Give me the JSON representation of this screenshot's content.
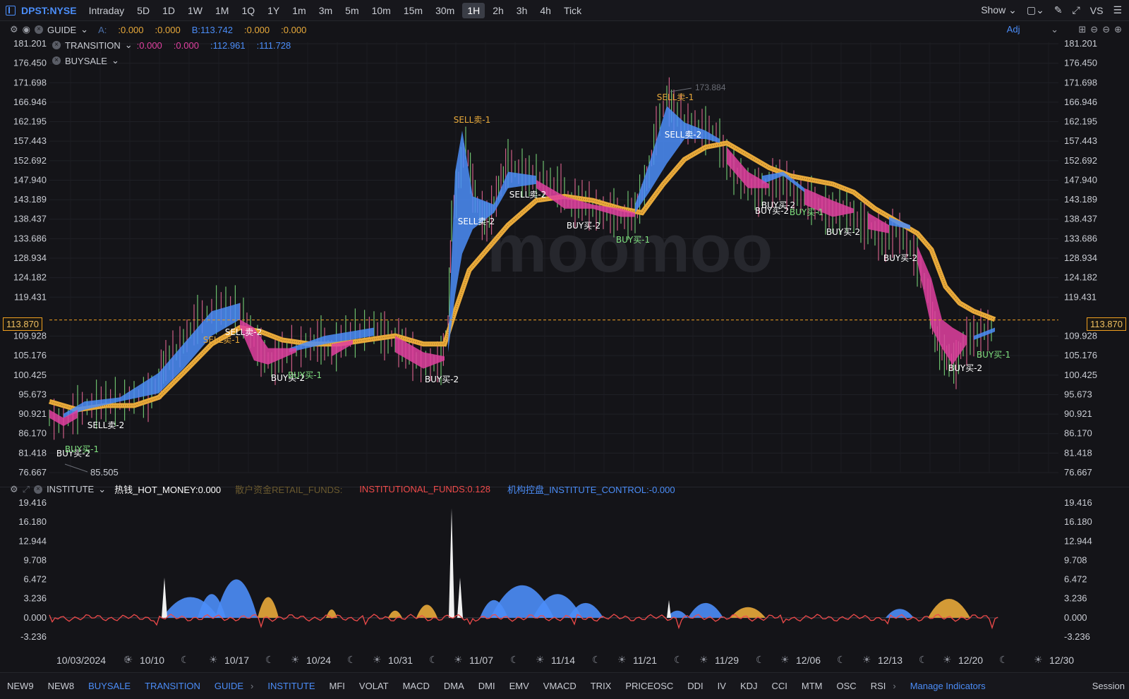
{
  "topbar": {
    "symbol": "DPST:NYSE",
    "timeframes": [
      "Intraday",
      "5D",
      "1D",
      "1W",
      "1M",
      "1Q",
      "1Y",
      "1m",
      "3m",
      "5m",
      "10m",
      "15m",
      "30m",
      "1H",
      "2h",
      "3h",
      "4h",
      "Tick"
    ],
    "active_timeframe": "1H",
    "show_label": "Show",
    "vs_label": "VS"
  },
  "main_panel": {
    "indicators": [
      {
        "name": "GUIDE",
        "values": [
          "A:",
          ":0.000",
          ":0.000",
          "B:113.742",
          ":0.000",
          ":0.000"
        ]
      },
      {
        "name": "TRANSITION",
        "values": [
          ":0.000",
          ":0.000",
          ":112.961",
          ":111.728"
        ]
      },
      {
        "name": "BUYSALE",
        "values": []
      }
    ],
    "adj_label": "Adj",
    "watermark": "moomoo",
    "current_price": "113.870",
    "high_label": "173.884",
    "low_label": "85.505",
    "price_axis": [
      "181.201",
      "176.450",
      "171.698",
      "166.946",
      "162.195",
      "157.443",
      "152.692",
      "147.940",
      "143.189",
      "138.437",
      "133.686",
      "128.934",
      "124.182",
      "119.431",
      "109.928",
      "105.176",
      "100.425",
      "95.673",
      "90.921",
      "86.170",
      "81.418",
      "76.667"
    ],
    "signals": [
      {
        "text": "SELL卖-1",
        "color": "#e8a93a"
      },
      {
        "text": "SELL卖-1",
        "color": "#e8a93a"
      },
      {
        "text": "SELL卖-1",
        "color": "#e8a93a"
      },
      {
        "text": "SELL卖-2",
        "color": "#ffffff"
      },
      {
        "text": "SELL卖-2",
        "color": "#ffffff"
      },
      {
        "text": "SELL卖-2",
        "color": "#ffffff"
      },
      {
        "text": "SELL卖-2",
        "color": "#ffffff"
      },
      {
        "text": "SELL卖-2",
        "color": "#ffffff"
      },
      {
        "text": "BUY买-2",
        "color": "#ffffff"
      },
      {
        "text": "BUY买-1",
        "color": "#7ee07e"
      },
      {
        "text": "BUY买-2",
        "color": "#ffffff"
      },
      {
        "text": "BUY买-1",
        "color": "#7ee07e"
      },
      {
        "text": "BUY买-2",
        "color": "#ffffff"
      },
      {
        "text": "BUY买-2",
        "color": "#ffffff"
      },
      {
        "text": "BUY买-1",
        "color": "#7ee07e"
      },
      {
        "text": "BUY买-2",
        "color": "#ffffff"
      },
      {
        "text": "BUY买-2",
        "color": "#ffffff"
      },
      {
        "text": "BUY买-1",
        "color": "#7ee07e"
      },
      {
        "text": "BUY买-2",
        "color": "#ffffff"
      },
      {
        "text": "BUY买-2",
        "color": "#ffffff"
      },
      {
        "text": "BUY买-2",
        "color": "#ffffff"
      },
      {
        "text": "BUY买-1",
        "color": "#7ee07e"
      }
    ]
  },
  "sub_panel": {
    "indicator": "INSTITUTE",
    "hot_money": "热钱_HOT_MONEY:0.000",
    "retail_funds": "散户资金RETAIL_FUNDS:",
    "institutional_funds": "INSTITUTIONAL_FUNDS:0.128",
    "institute_control": "机构控盘_INSTITUTE_CONTROL:-0.000",
    "axis": [
      "19.416",
      "16.180",
      "12.944",
      "9.708",
      "6.472",
      "3.236",
      "0.000",
      "-3.236"
    ]
  },
  "dates": [
    "10/03/2024",
    "10/10",
    "10/17",
    "10/24",
    "10/31",
    "11/07",
    "11/14",
    "11/21",
    "11/29",
    "12/06",
    "12/13",
    "12/20",
    "12/30"
  ],
  "bottom_tabs": [
    "NEW9",
    "NEW8",
    "BUYSALE",
    "TRANSITION",
    "GUIDE",
    "INSTITUTE",
    "MFI",
    "VOLAT",
    "MACD",
    "DMA",
    "DMI",
    "EMV",
    "VMACD",
    "TRIX",
    "PRICEOSC",
    "DDI",
    "IV",
    "KDJ",
    "CCI",
    "MTM",
    "OSC",
    "RSI"
  ],
  "blue_tabs": [
    "BUYSALE",
    "TRANSITION",
    "GUIDE",
    "INSTITUTE"
  ],
  "manage_label": "Manage Indicators",
  "session_label": "Session",
  "colors": {
    "blue": "#4b8df8",
    "gold": "#e8a93a",
    "magenta": "#e040a0",
    "green": "#7ee07e",
    "red": "#ef4a4a",
    "bg": "#141418"
  }
}
